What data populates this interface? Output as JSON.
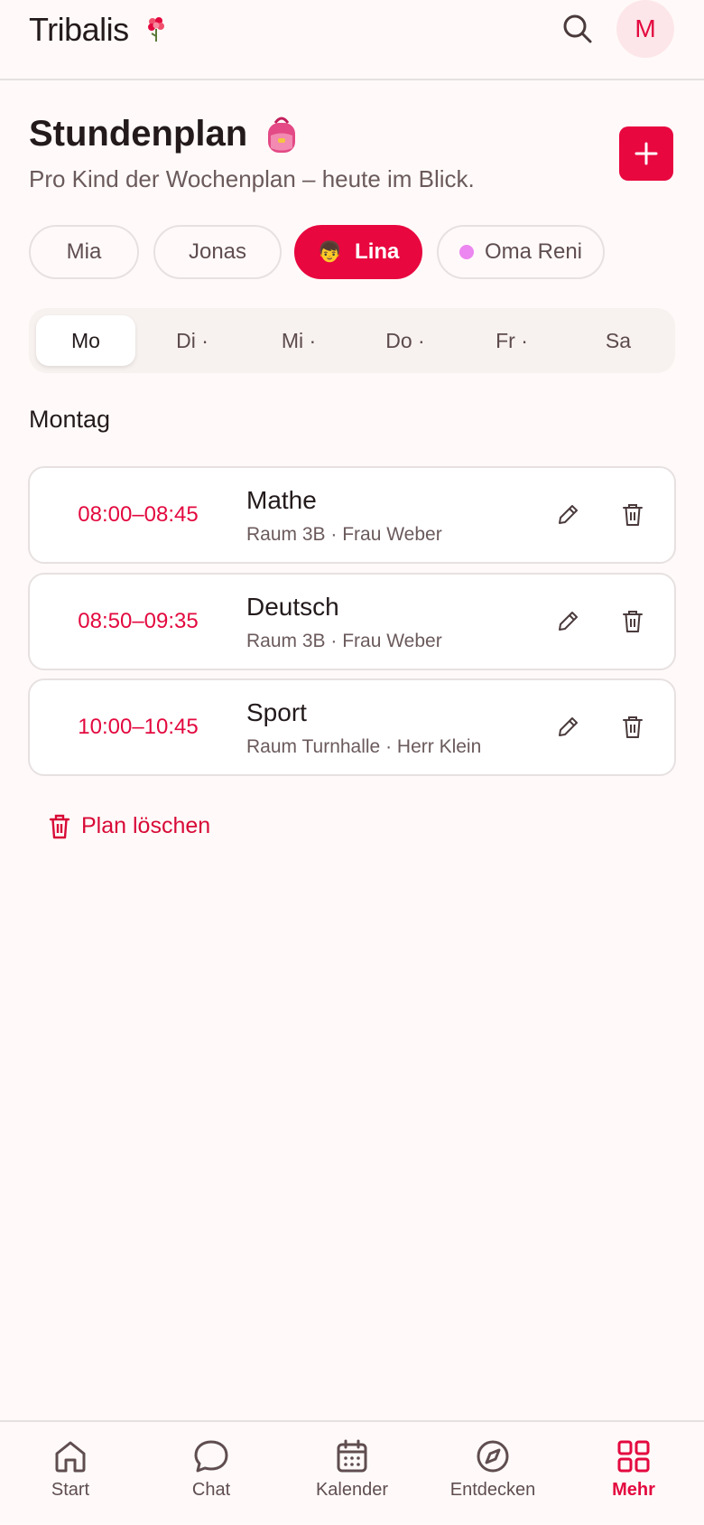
{
  "header": {
    "brand": "Tribalis",
    "avatar_initial": "M",
    "icons": [
      "flower-icon",
      "search-icon"
    ]
  },
  "page": {
    "title": "Stundenplan",
    "subtitle": "Pro Kind der Wochenplan – heute im Blick.",
    "add_icon": "plus-icon"
  },
  "children": [
    {
      "name": "Mia",
      "active": false
    },
    {
      "name": "Jonas",
      "active": false
    },
    {
      "name": "Lina",
      "active": true,
      "emoji": "👦"
    },
    {
      "name": "Oma Reni",
      "active": false,
      "dot_color": "#ec86f0"
    }
  ],
  "days": [
    {
      "label": "Mo",
      "active": true
    },
    {
      "label": "Di ·",
      "active": false
    },
    {
      "label": "Mi ·",
      "active": false
    },
    {
      "label": "Do ·",
      "active": false
    },
    {
      "label": "Fr ·",
      "active": false
    },
    {
      "label": "Sa",
      "active": false
    }
  ],
  "day_heading": "Montag",
  "lessons": [
    {
      "time": "08:00–08:45",
      "subject": "Mathe",
      "meta": "Raum 3B · Frau Weber"
    },
    {
      "time": "08:50–09:35",
      "subject": "Deutsch",
      "meta": "Raum 3B · Frau Weber"
    },
    {
      "time": "10:00–10:45",
      "subject": "Sport",
      "meta": "Raum Turnhalle · Herr Klein"
    }
  ],
  "clear_plan_label": "Plan löschen",
  "nav": [
    {
      "label": "Start",
      "icon": "home-icon",
      "active": false
    },
    {
      "label": "Chat",
      "icon": "chat-icon",
      "active": false
    },
    {
      "label": "Kalender",
      "icon": "calendar-icon",
      "active": false
    },
    {
      "label": "Entdecken",
      "icon": "compass-icon",
      "active": false
    },
    {
      "label": "Mehr",
      "icon": "grid-icon",
      "active": true
    }
  ],
  "colors": {
    "accent": "#e8073f",
    "background": "#fffaf9",
    "chip_dot": "#ec86f0"
  }
}
